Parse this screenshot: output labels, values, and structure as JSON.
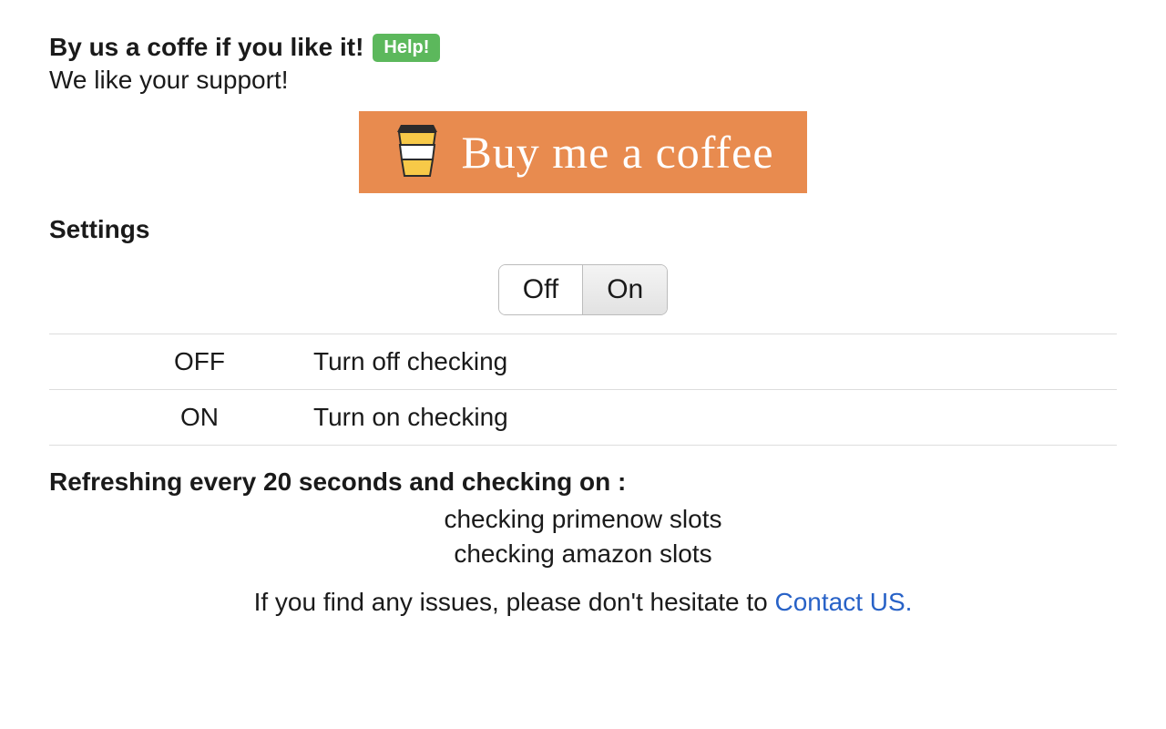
{
  "header": {
    "title": "By us a coffe if you like it!",
    "help_badge": "Help!",
    "subtitle": "We like your support!"
  },
  "coffee_banner": {
    "label": "Buy me a coffee"
  },
  "settings": {
    "heading": "Settings",
    "toggle": {
      "off_label": "Off",
      "on_label": "On",
      "active": "On"
    },
    "rows": [
      {
        "key": "OFF",
        "desc": "Turn off checking"
      },
      {
        "key": "ON",
        "desc": "Turn on checking"
      }
    ]
  },
  "status": {
    "heading": "Refreshing every 20 seconds and checking on :",
    "lines": [
      "checking primenow slots",
      "checking amazon slots"
    ]
  },
  "contact": {
    "prefix": "If you find any issues, please don't hesitate to ",
    "link": "Contact US."
  }
}
